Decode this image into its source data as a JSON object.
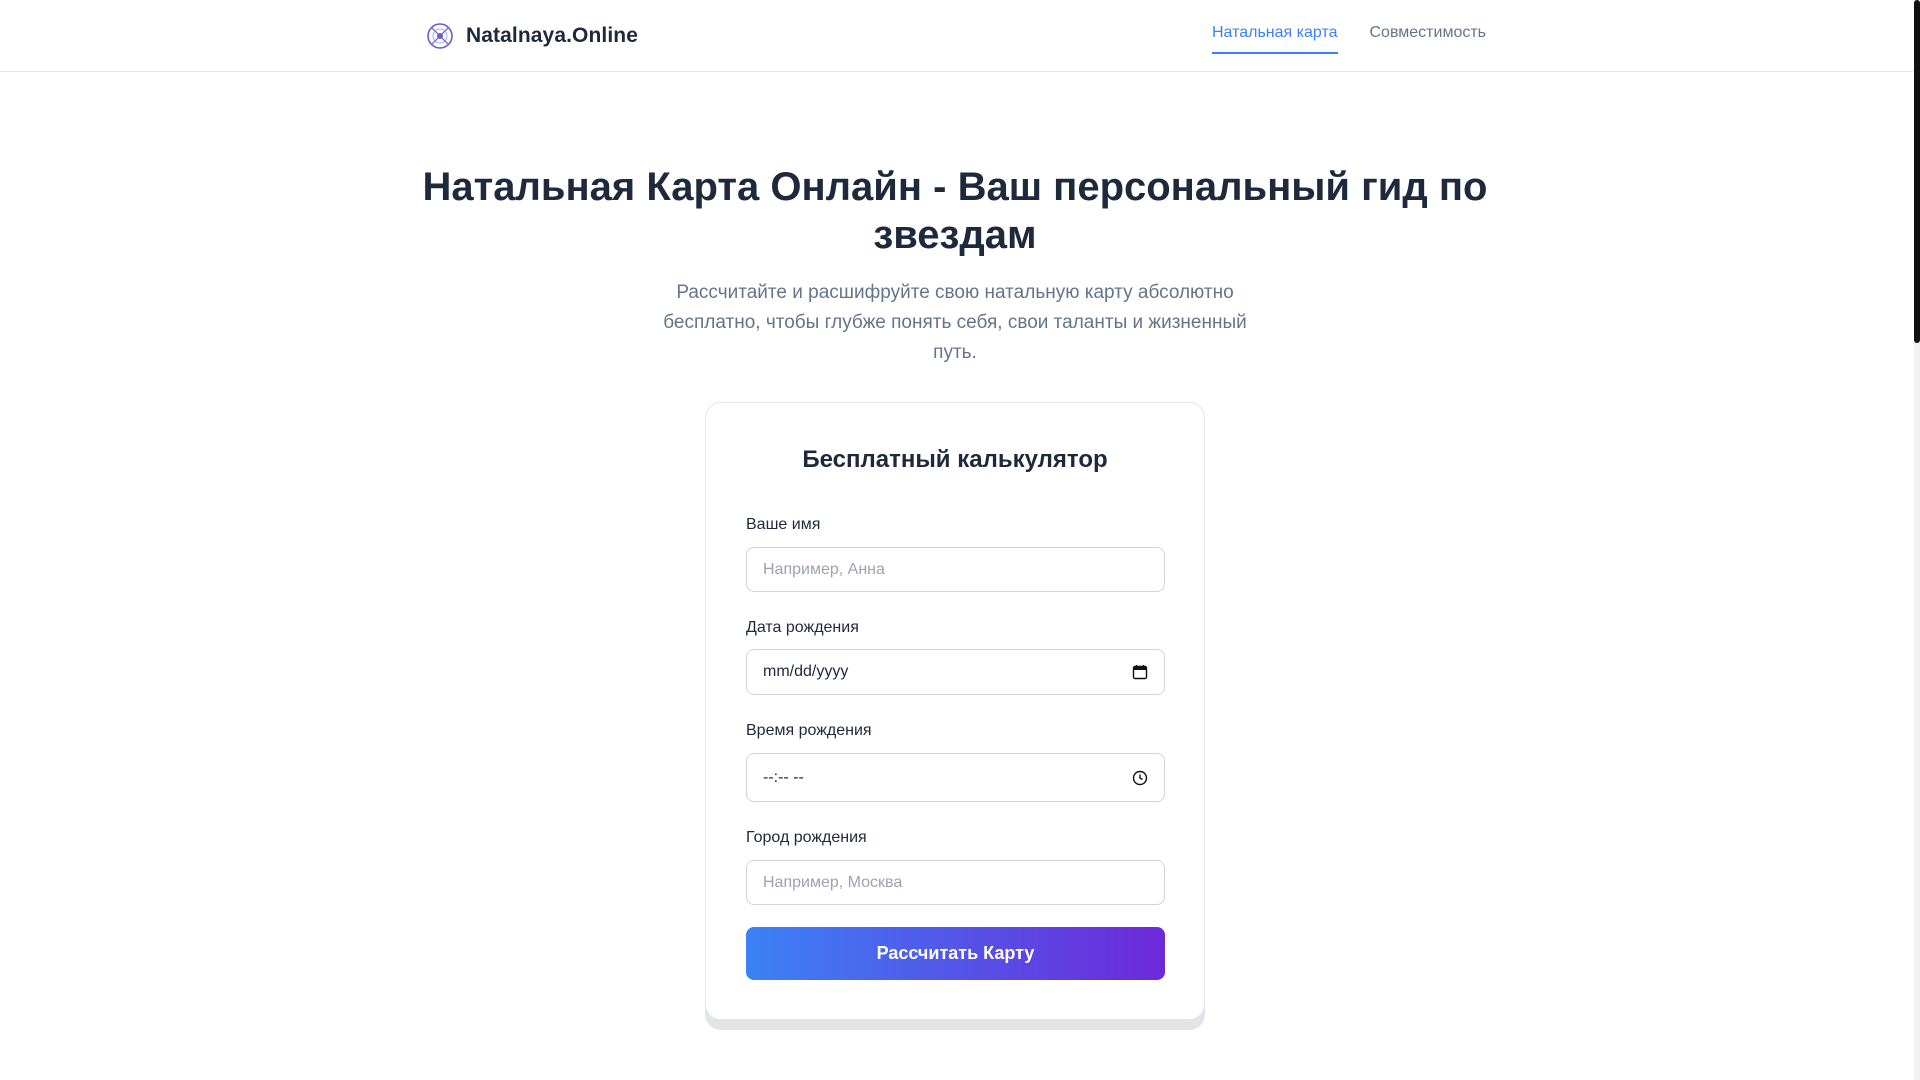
{
  "header": {
    "logo_text": "Natalnaya.Online",
    "logo_icon": "zodiac-wheel-icon",
    "nav": [
      {
        "label": "Натальная карта",
        "active": true
      },
      {
        "label": "Совместимость",
        "active": false
      }
    ]
  },
  "hero": {
    "title": "Натальная Карта Онлайн - Ваш персональный гид по звездам",
    "subtitle": "Рассчитайте и расшифруйте свою натальную карту абсолютно бесплатно, чтобы глубже понять себя, свои таланты и жизненный путь."
  },
  "form": {
    "title": "Бесплатный калькулятор",
    "name": {
      "label": "Ваше имя",
      "placeholder": "Например, Анна",
      "value": ""
    },
    "date": {
      "label": "Дата рождения",
      "value": "mm/dd/yyyy",
      "icon": "calendar-icon"
    },
    "time": {
      "label": "Время рождения",
      "value": "--:-- --",
      "icon": "clock-icon"
    },
    "city": {
      "label": "Город рождения",
      "placeholder": "Например, Москва",
      "value": ""
    },
    "submit_label": "Рассчитать Карту"
  },
  "colors": {
    "accent": "#3b82f6",
    "button_gradient_start": "#3b82f6",
    "button_gradient_end": "#6d28d9",
    "heading": "#1e293b",
    "muted": "#64748b"
  }
}
